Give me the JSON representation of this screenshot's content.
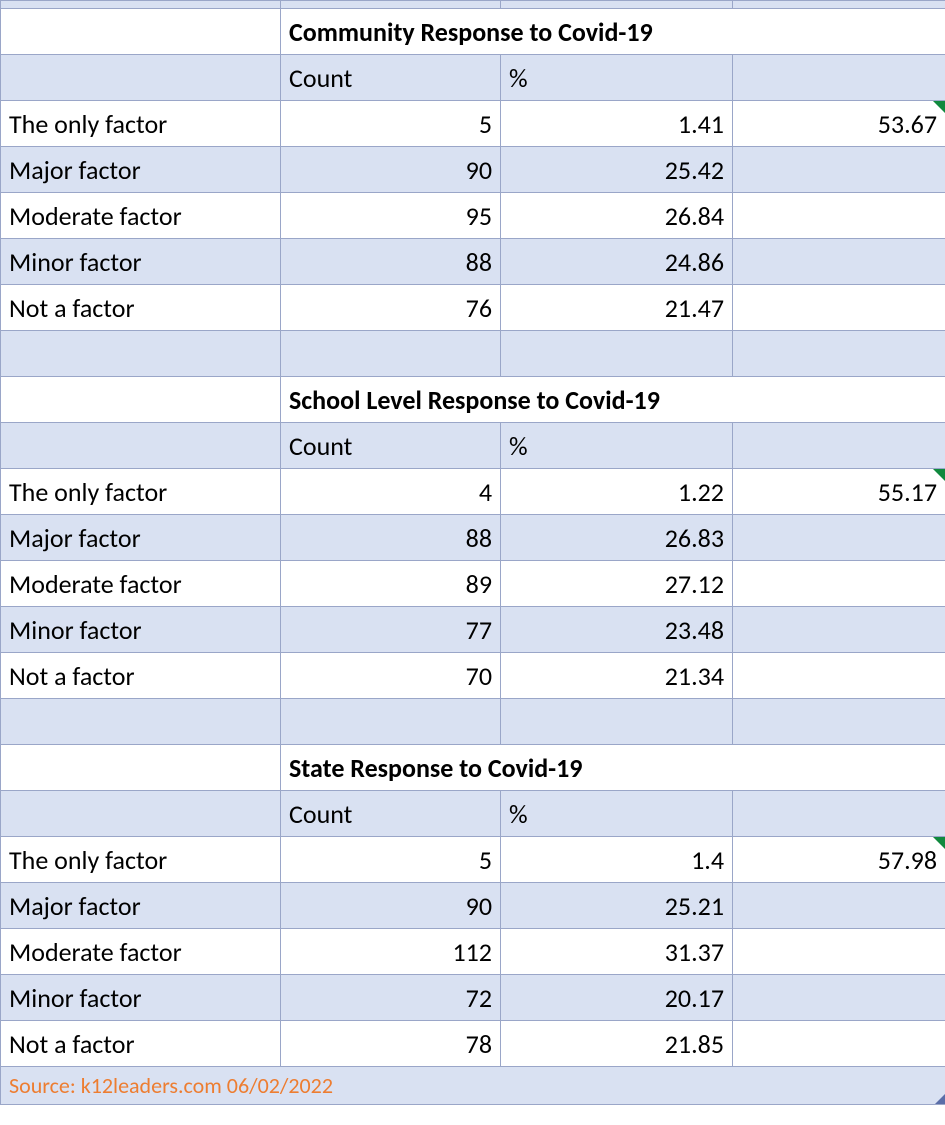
{
  "sections": [
    {
      "title": "Community Response to Covid-19",
      "colhead1": "Count",
      "colhead2": "%",
      "summary": "53.67",
      "rows": [
        {
          "label": "The only factor",
          "count": "5",
          "pct": "1.41"
        },
        {
          "label": "Major factor",
          "count": "90",
          "pct": "25.42"
        },
        {
          "label": "Moderate factor",
          "count": "95",
          "pct": "26.84"
        },
        {
          "label": "Minor factor",
          "count": "88",
          "pct": "24.86"
        },
        {
          "label": "Not a factor",
          "count": "76",
          "pct": "21.47"
        }
      ]
    },
    {
      "title": "School Level Response to Covid-19",
      "colhead1": "Count",
      "colhead2": "%",
      "summary": "55.17",
      "rows": [
        {
          "label": "The only factor",
          "count": "4",
          "pct": "1.22"
        },
        {
          "label": "Major factor",
          "count": "88",
          "pct": "26.83"
        },
        {
          "label": "Moderate factor",
          "count": "89",
          "pct": "27.12"
        },
        {
          "label": "Minor factor",
          "count": "77",
          "pct": "23.48"
        },
        {
          "label": "Not a factor",
          "count": "70",
          "pct": "21.34"
        }
      ]
    },
    {
      "title": "State Response to Covid-19",
      "colhead1": "Count",
      "colhead2": "%",
      "summary": "57.98",
      "rows": [
        {
          "label": "The only factor",
          "count": "5",
          "pct": "1.4"
        },
        {
          "label": "Major factor",
          "count": "90",
          "pct": "25.21"
        },
        {
          "label": "Moderate factor",
          "count": "112",
          "pct": "31.37"
        },
        {
          "label": "Minor factor",
          "count": "72",
          "pct": "20.17"
        },
        {
          "label": "Not a factor",
          "count": "78",
          "pct": "21.85"
        }
      ]
    }
  ],
  "source": "Source: k12leaders.com 06/02/2022",
  "chart_data": [
    {
      "type": "table",
      "title": "Community Response to Covid-19",
      "categories": [
        "The only factor",
        "Major factor",
        "Moderate factor",
        "Minor factor",
        "Not a factor"
      ],
      "series": [
        {
          "name": "Count",
          "values": [
            5,
            90,
            95,
            88,
            76
          ]
        },
        {
          "name": "%",
          "values": [
            1.41,
            25.42,
            26.84,
            24.86,
            21.47
          ]
        }
      ],
      "summary_value": 53.67
    },
    {
      "type": "table",
      "title": "School Level Response to Covid-19",
      "categories": [
        "The only factor",
        "Major factor",
        "Moderate factor",
        "Minor factor",
        "Not a factor"
      ],
      "series": [
        {
          "name": "Count",
          "values": [
            4,
            88,
            89,
            77,
            70
          ]
        },
        {
          "name": "%",
          "values": [
            1.22,
            26.83,
            27.12,
            23.48,
            21.34
          ]
        }
      ],
      "summary_value": 55.17
    },
    {
      "type": "table",
      "title": "State Response to Covid-19",
      "categories": [
        "The only factor",
        "Major factor",
        "Moderate factor",
        "Minor factor",
        "Not a factor"
      ],
      "series": [
        {
          "name": "Count",
          "values": [
            5,
            90,
            112,
            72,
            78
          ]
        },
        {
          "name": "%",
          "values": [
            1.4,
            25.21,
            31.37,
            20.17,
            21.85
          ]
        }
      ],
      "summary_value": 57.98
    }
  ]
}
